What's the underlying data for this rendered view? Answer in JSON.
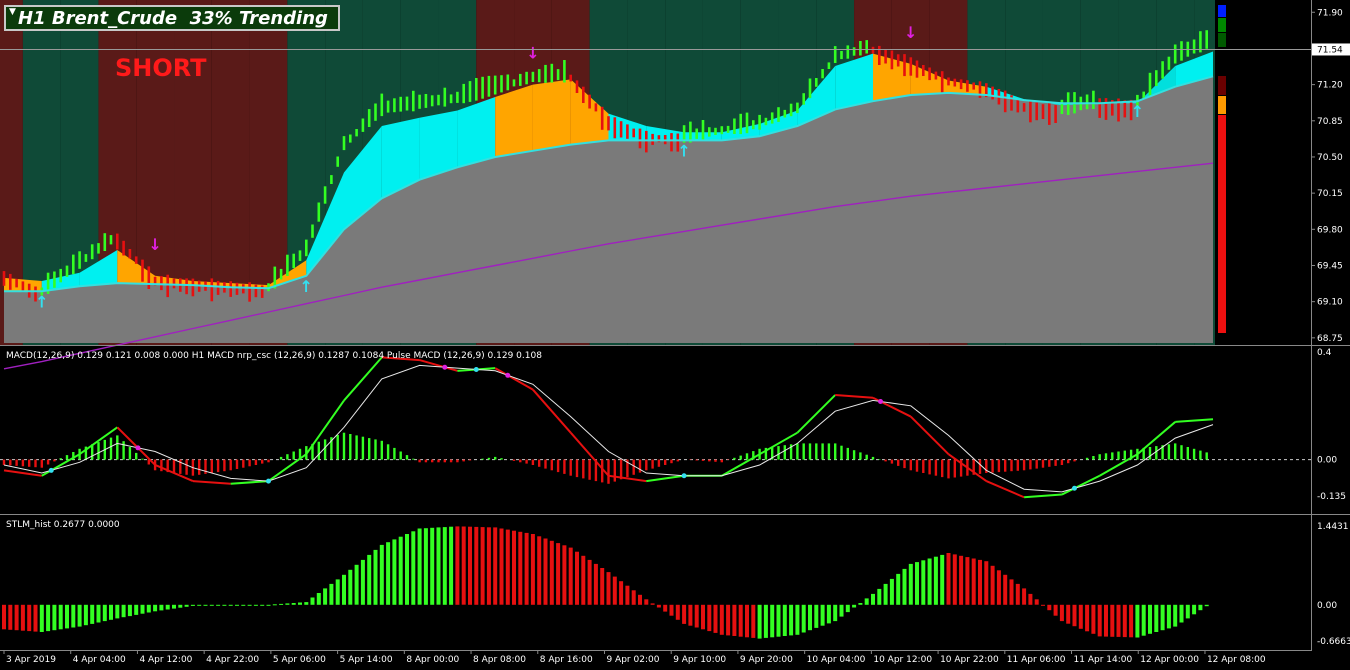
{
  "title_bar": {
    "text": "H1 Brent_Crude  33% Trending"
  },
  "signal": {
    "text": "SHORT",
    "color": "#ff1a1a"
  },
  "colors": {
    "background": "#000000",
    "main_fill": "#7a7a7a",
    "bull_zone": "#0f4a37",
    "bear_zone": "#5a1a18",
    "ribbon_bull": "#00f0f0",
    "ribbon_bear": "#ffa500",
    "bar_up": "#33ff22",
    "bar_down": "#e61010",
    "ema": "#33e0e0",
    "ma_long": "#a020c0",
    "macd_pos": "#33ff22",
    "macd_neg": "#e61010",
    "arrow_buy": "#33e0f0",
    "arrow_sell": "#e020e0"
  },
  "chart_data": [
    {
      "type": "candlestick",
      "name": "H1 Brent_Crude",
      "y_ticks": [
        "71.90",
        "71.54",
        "71.20",
        "70.85",
        "70.50",
        "70.15",
        "69.80",
        "69.45",
        "69.10",
        "68.75"
      ],
      "current_price": "71.54",
      "ylim": [
        68.7,
        71.98
      ],
      "x_ticks": [
        "3 Apr 2019",
        "4 Apr 04:00",
        "4 Apr 12:00",
        "4 Apr 22:00",
        "5 Apr 06:00",
        "5 Apr 14:00",
        "8 Apr 00:00",
        "8 Apr 08:00",
        "8 Apr 16:00",
        "9 Apr 02:00",
        "9 Apr 10:00",
        "9 Apr 20:00",
        "10 Apr 04:00",
        "10 Apr 12:00",
        "10 Apr 22:00",
        "11 Apr 06:00",
        "11 Apr 14:00",
        "12 Apr 00:00",
        "12 Apr 08:00"
      ],
      "close": [
        69.36,
        69.18,
        69.46,
        69.72,
        69.32,
        69.28,
        69.26,
        69.22,
        69.58,
        70.6,
        70.95,
        71.0,
        71.05,
        71.15,
        71.25,
        71.28,
        70.86,
        70.7,
        70.68,
        70.74,
        70.8,
        70.95,
        71.45,
        71.55,
        71.42,
        71.25,
        71.18,
        71.0,
        70.95,
        71.02,
        71.0,
        71.45,
        71.62
      ],
      "ema_fast": [
        69.33,
        69.3,
        69.38,
        69.6,
        69.35,
        69.3,
        69.28,
        69.26,
        69.5,
        70.35,
        70.8,
        70.88,
        70.95,
        71.08,
        71.2,
        71.25,
        70.92,
        70.8,
        70.74,
        70.74,
        70.82,
        70.95,
        71.38,
        71.5,
        71.4,
        71.24,
        71.18,
        71.06,
        71.0,
        71.02,
        71.02,
        71.38,
        71.52
      ],
      "ema_mid": [
        69.2,
        69.2,
        69.25,
        69.28,
        69.27,
        69.26,
        69.24,
        69.23,
        69.35,
        69.8,
        70.1,
        70.28,
        70.4,
        70.5,
        70.56,
        70.62,
        70.66,
        70.66,
        70.66,
        70.66,
        70.7,
        70.8,
        70.96,
        71.04,
        71.1,
        71.12,
        71.1,
        71.05,
        71.02,
        71.02,
        71.04,
        71.18,
        71.28
      ],
      "ma_long": [
        68.45,
        68.52,
        68.6,
        68.68,
        68.76,
        68.84,
        68.92,
        69.0,
        69.08,
        69.16,
        69.24,
        69.31,
        69.38,
        69.45,
        69.52,
        69.59,
        69.66,
        69.72,
        69.78,
        69.84,
        69.9,
        69.96,
        70.02,
        70.07,
        70.12,
        70.16,
        70.2,
        70.24,
        70.28,
        70.32,
        70.36,
        70.4,
        70.44
      ],
      "zones": [
        "bear",
        "bull",
        "bull",
        "bear",
        "bear",
        "bear",
        "bear",
        "bear",
        "bull",
        "bull",
        "bull",
        "bull",
        "bull",
        "bear",
        "bear",
        "bear",
        "bull",
        "bull",
        "bull",
        "bull",
        "bull",
        "bull",
        "bull",
        "bear",
        "bear",
        "bear",
        "bull",
        "bull",
        "bull",
        "bull",
        "bull",
        "bull",
        "bull"
      ],
      "arrows": [
        {
          "type": "buy",
          "index": 1
        },
        {
          "type": "sell",
          "index": 4
        },
        {
          "type": "buy",
          "index": 8
        },
        {
          "type": "sell",
          "index": 14
        },
        {
          "type": "buy",
          "index": 18
        },
        {
          "type": "sell",
          "index": 24
        },
        {
          "type": "buy",
          "index": 30
        }
      ]
    },
    {
      "type": "line",
      "title": "MACD(12,26,9) 0.129 0.121 0.008 0.000  H1 MACD nrp_csc (12,26,9) 0.1287 0.1084  Pulse MACD (12,26,9) 0.129 0.108",
      "y_ticks": [
        "0.4",
        "0.00",
        "-0.135"
      ],
      "ylim": [
        -0.18,
        0.4
      ],
      "macd": [
        -0.04,
        -0.06,
        0.02,
        0.12,
        -0.02,
        -0.08,
        -0.09,
        -0.08,
        0.02,
        0.22,
        0.38,
        0.37,
        0.33,
        0.34,
        0.26,
        0.1,
        -0.06,
        -0.08,
        -0.06,
        -0.06,
        0.02,
        0.1,
        0.24,
        0.23,
        0.16,
        0.02,
        -0.08,
        -0.14,
        -0.13,
        -0.06,
        0.02,
        0.14,
        0.15
      ],
      "signal": [
        -0.02,
        -0.05,
        -0.01,
        0.06,
        0.03,
        -0.03,
        -0.07,
        -0.08,
        -0.03,
        0.12,
        0.3,
        0.35,
        0.34,
        0.33,
        0.28,
        0.16,
        0.03,
        -0.05,
        -0.06,
        -0.06,
        -0.02,
        0.06,
        0.18,
        0.22,
        0.2,
        0.09,
        -0.04,
        -0.11,
        -0.12,
        -0.08,
        -0.02,
        0.08,
        0.13
      ],
      "histogram": [
        -0.02,
        -0.03,
        0.04,
        0.09,
        -0.04,
        -0.06,
        -0.04,
        -0.01,
        0.05,
        0.1,
        0.07,
        -0.01,
        -0.01,
        0.01,
        -0.02,
        -0.06,
        -0.09,
        -0.04,
        0.0,
        -0.01,
        0.04,
        0.06,
        0.06,
        0.01,
        -0.04,
        -0.07,
        -0.05,
        -0.04,
        -0.02,
        0.02,
        0.04,
        0.06,
        0.02
      ]
    },
    {
      "type": "bar",
      "title": "STLM_hist 0.2677 0.0000",
      "y_ticks": [
        "1.4431",
        "0.00",
        "-0.6663"
      ],
      "ylim": [
        -0.72,
        1.52
      ],
      "values": [
        -0.45,
        -0.5,
        -0.4,
        -0.25,
        -0.12,
        -0.02,
        0.0,
        0.0,
        0.05,
        0.55,
        1.1,
        1.4,
        1.44,
        1.42,
        1.3,
        1.05,
        0.6,
        0.1,
        -0.35,
        -0.55,
        -0.62,
        -0.55,
        -0.3,
        0.2,
        0.75,
        0.95,
        0.8,
        0.3,
        -0.3,
        -0.58,
        -0.6,
        -0.4,
        0.05
      ]
    }
  ]
}
